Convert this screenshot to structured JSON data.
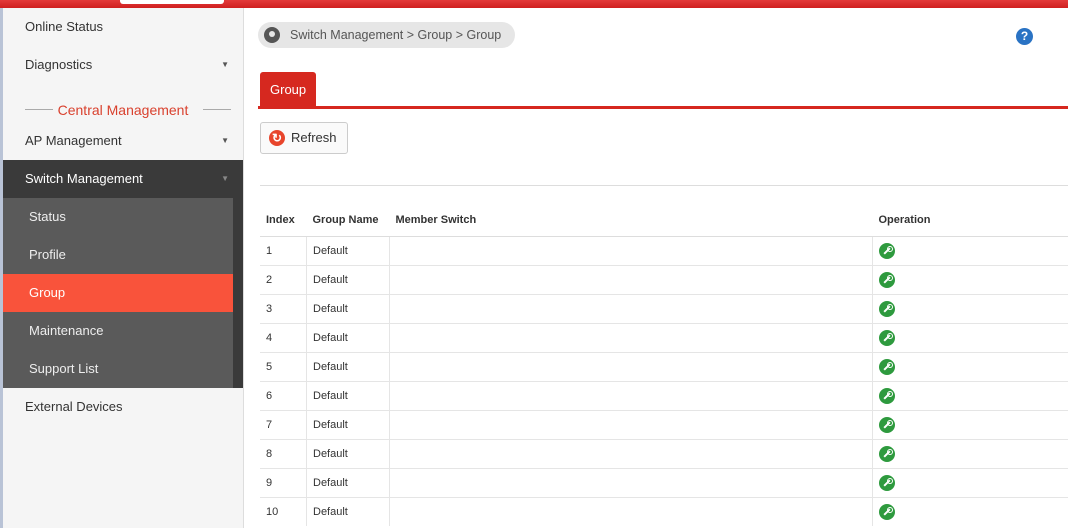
{
  "sidebar": {
    "top_items": [
      {
        "label": "Online Status",
        "has_caret": false
      },
      {
        "label": "Diagnostics",
        "has_caret": true
      }
    ],
    "section_title": "Central Management",
    "ap_management": "AP Management",
    "switch_management": "Switch Management",
    "switch_sub_items": [
      "Status",
      "Profile",
      "Group",
      "Maintenance",
      "Support List"
    ],
    "active_sub_item": "Group",
    "external_devices": "External Devices"
  },
  "breadcrumb": "Switch Management > Group > Group",
  "tabs": [
    {
      "label": "Group",
      "active": true
    }
  ],
  "toolbar": {
    "refresh_label": "Refresh"
  },
  "table": {
    "headers": [
      "Index",
      "Group Name",
      "Member Switch",
      "Operation"
    ],
    "rows": [
      {
        "index": "1",
        "group_name": "Default",
        "member_switch": ""
      },
      {
        "index": "2",
        "group_name": "Default",
        "member_switch": ""
      },
      {
        "index": "3",
        "group_name": "Default",
        "member_switch": ""
      },
      {
        "index": "4",
        "group_name": "Default",
        "member_switch": ""
      },
      {
        "index": "5",
        "group_name": "Default",
        "member_switch": ""
      },
      {
        "index": "6",
        "group_name": "Default",
        "member_switch": ""
      },
      {
        "index": "7",
        "group_name": "Default",
        "member_switch": ""
      },
      {
        "index": "8",
        "group_name": "Default",
        "member_switch": ""
      },
      {
        "index": "9",
        "group_name": "Default",
        "member_switch": ""
      },
      {
        "index": "10",
        "group_name": "Default",
        "member_switch": ""
      }
    ]
  },
  "icons": {
    "breadcrumb": "location-pin-icon",
    "help": "help-icon",
    "refresh": "refresh-icon",
    "operation": "wrench-icon"
  },
  "colors": {
    "accent_red": "#d6281f",
    "active_orange": "#f9533b",
    "sidebar_dark": "#3a3a3a",
    "sidebar_sub": "#5a5a5a",
    "help_blue": "#2a73c4",
    "operation_green": "#2e9a3e"
  }
}
